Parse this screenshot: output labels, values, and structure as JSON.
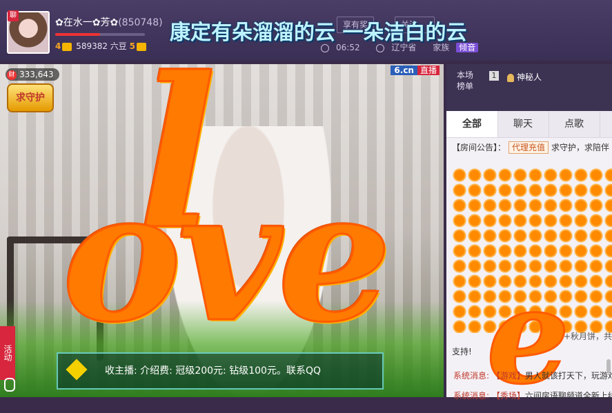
{
  "header": {
    "room_badge": "聊",
    "host_name": "✿在水一✿芳✿",
    "host_id": "(850748)",
    "level_left": "4",
    "beans": "589382 六豆",
    "level_right": "5",
    "btn_gift": "享有奖",
    "btn_follow": "关注",
    "marquee": "康定有朵溜溜的云   一朵洁白的云",
    "time": "06:52",
    "location": "辽宁省",
    "family": "家族",
    "fan_tag": "倾音"
  },
  "video": {
    "wealth_label": "财",
    "wealth_value": "333,643",
    "guard_label": "求守护",
    "logo": "6.cn",
    "live_label": "直播",
    "love_first": "l",
    "love_rest": "ove",
    "activity_label": "活动",
    "ticker": "收主播: 介绍费: 冠级200元: 钻级100元。联系QQ"
  },
  "sidebar": {
    "rank_label": "本场榜单",
    "rank_num": "1",
    "rank_user": "神秘人"
  },
  "chat": {
    "tabs": [
      "全部",
      "聊天",
      "点歌"
    ],
    "notice_label": "【房间公告】：",
    "notice_btn": "代理充值",
    "notice_text": "求守护，求陪伴",
    "gift_line": "+秋月饼，共",
    "support": "支持!",
    "sys1_key": "系统消息:",
    "sys1_tag": "【游戏】",
    "sys1_body": "男人就该打天下，玩游戏",
    "sys2_key": "系统消息:",
    "sys2_tag": "【秀场】",
    "sys2_body": "六间房语聊频道全新上线"
  }
}
